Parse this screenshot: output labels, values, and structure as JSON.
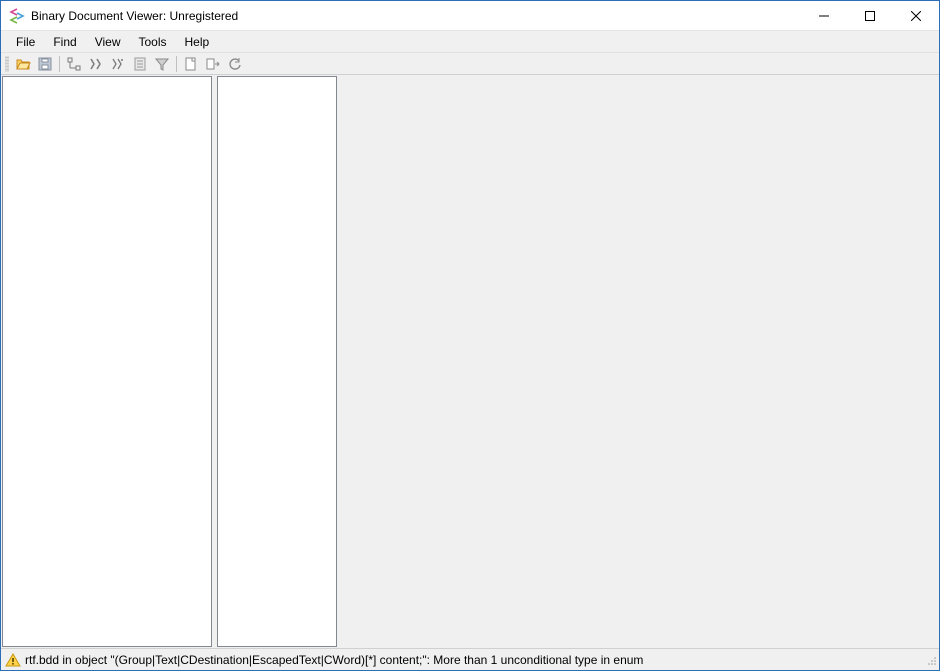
{
  "window": {
    "title": "Binary Document Viewer: Unregistered"
  },
  "menu": {
    "file": "File",
    "find": "Find",
    "view": "View",
    "tools": "Tools",
    "help": "Help"
  },
  "status": {
    "message": "rtf.bdd in object \"(Group|Text|CDestination|EscapedText|CWord)[*] content;\": More than 1 unconditional type in enum"
  }
}
